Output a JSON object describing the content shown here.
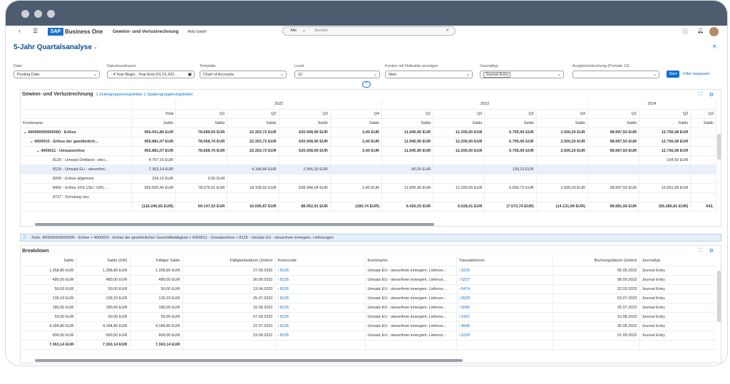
{
  "shell": {
    "app_name": "Business One",
    "sap": "SAP",
    "page": "Gewinn- und Verlustrechnung",
    "company": "ANG GmbH",
    "scope": "Alle",
    "search_placeholder": "Suchen"
  },
  "page_title": "5-Jahr Quartalsanalyse",
  "filters": [
    {
      "label": "Date:",
      "value": "Posting Date"
    },
    {
      "label": "Datumszeitraum:",
      "value": "- 4 Year:Begin...Year:End (01.01.202..."
    },
    {
      "label": "Template:",
      "value": "Chart of Accounts"
    },
    {
      "label": "Level:",
      "value": "10"
    },
    {
      "label": "Konten mit Nullsaldo anzeigen:",
      "value": "Nein"
    },
    {
      "label": "Journaltyp:",
      "value": "Journal Entry"
    },
    {
      "label": "Ausgleichsbuchung (Periode 13):",
      "value": ""
    }
  ],
  "start_label": "Start",
  "filter_label": "Filter anpassen",
  "pl": {
    "title": "Gewinn- und Verlustrechnung",
    "sub": "1 Zeilengruppierungsfelder 1 Spaltengruppierungsfelder",
    "years": [
      "2022",
      "2023",
      "2024"
    ],
    "quarters": [
      "Total",
      "Q1",
      "Q2",
      "Q3",
      "Q4",
      "Q1",
      "Q2",
      "Q3",
      "Q4",
      "Q1",
      "Q2",
      "Q3"
    ],
    "saldo": "Saldo",
    "kontoname": "Kontoname",
    "rows": [
      {
        "name": "400000000000000 - Erlöse",
        "lvl": 1,
        "bold": true,
        "v": [
          "956.001,86 EUR",
          "78.689,55 EUR",
          "22.353,72 EUR",
          "620.008,90 EUR",
          "2,40 EUR",
          "11.945,90 EUR",
          "12.200,00 EUR",
          "6.795,95 EUR",
          "2.500,20 EUR",
          "98.997,50 EUR",
          "12.756,08 EUR",
          ""
        ]
      },
      {
        "name": "4000010 - Erlöse der gewöhnlich...",
        "lvl": 2,
        "bold": true,
        "v": [
          "955.881,07 EUR",
          "78.568,76 EUR",
          "22.353,72 EUR",
          "620.008,90 EUR",
          "2,40 EUR",
          "11.945,90 EUR",
          "12.200,00 EUR",
          "6.795,95 EUR",
          "2.500,20 EUR",
          "98.997,50 EUR",
          "12.756,08 EUR",
          ""
        ]
      },
      {
        "name": "4000011 - Umsatzerlöse",
        "lvl": 3,
        "bold": true,
        "v": [
          "955.881,07 EUR",
          "78.568,76 EUR",
          "22.353,72 EUR",
          "620.008,90 EUR",
          "2,40 EUR",
          "11.945,90 EUR",
          "12.200,00 EUR",
          "6.795,95 EUR",
          "2.500,20 EUR",
          "98.997,50 EUR",
          "12.756,08 EUR",
          ""
        ]
      },
      {
        "name": "8120 - Umsatz Drittland - steu...",
        "lvl": 4,
        "bold": false,
        "v": [
          "4.767,16 EUR",
          "",
          "",
          "",
          "",
          "",
          "",
          "",
          "",
          "",
          "104,50 EUR",
          ""
        ]
      },
      {
        "name": "8125 - Umsatz EU - steuerfrei...",
        "lvl": 4,
        "bold": false,
        "sel": true,
        "v": [
          "7.363,14 EUR",
          "",
          "4.184,80 EUR",
          "2.956,30 EUR",
          "",
          "50,00 EUR",
          "",
          "139,23 EUR",
          "",
          "",
          "",
          ""
        ]
      },
      {
        "name": "8200 - Erlöse allgemein",
        "lvl": 4,
        "bold": false,
        "v": [
          "154,15 EUR",
          "6,55 EUR",
          "",
          "",
          "",
          "",
          "",
          "",
          "",
          "",
          "",
          ""
        ]
      },
      {
        "name": "8400 - Erlöse 16% USt / 19% ...",
        "lvl": 4,
        "bold": false,
        "v": [
          "955.506,46 EUR",
          "78.576,61 EUR",
          "18.168,92 EUR",
          "628.948,04 EUR",
          "2,40 EUR",
          "11.895,90 EUR",
          "12.200,00 EUR",
          "6.656,72 EUR",
          "2.500,20 EUR",
          "98.997,50 EUR",
          "12.651,58 EUR",
          ""
        ]
      },
      {
        "name": "8727 - Schulung neu",
        "lvl": 4,
        "bold": false,
        "v": [
          "",
          "",
          "",
          "",
          "",
          "",
          "",
          "",
          "",
          "",
          "",
          ""
        ]
      }
    ],
    "total": [
      "(116.246,65 EUR)",
      "69.147,92 EUR",
      "16.695,87 EUR",
      "88.052,91 EUR",
      "(180,74 EUR)",
      "6.426,03 EUR",
      "9.028,01 EUR",
      "(7.573,74 EUR)",
      "(14.131,99 EUR)",
      "98.981,06 EUR",
      "(56.286,81 EUR)",
      "642,"
    ]
  },
  "info": "Zeile: 400000000000000 - Erlöse > 4000010 - Erlöse der gewöhnlichen Geschäftstätigkeit > 4000011 - Umsatzerlöse > 8125 - Umsatz EU - steuerfreie innergem. Lieferungen",
  "bd": {
    "title": "Breakdown",
    "headers": [
      "Saldo",
      "Saldo (SW)",
      "Fälliger Saldo",
      "Fälligkeitsdatum (Zeilen)",
      "Kontocode",
      "Kontoname",
      "Transaktionsnr.",
      "Buchungsdatum (Zeilen)",
      "Journaltyp"
    ],
    "rows": [
      [
        "1.358,80 EUR",
        "1.358,80 EUR",
        "1.358,80 EUR",
        "27.09.2022",
        "8125",
        "Umsatz EU - steuerfreie innergem. Lieferun...",
        "5226",
        "05.09.2022",
        "Journal Entry"
      ],
      [
        "480,00 EUR",
        "480,00 EUR",
        "480,00 EUR",
        "30.09.2022",
        "8125",
        "Umsatz EU - steuerfreie innergem. Lieferun...",
        "5227",
        "08.09.2022",
        "Journal Entry"
      ],
      [
        "50,00 EUR",
        "50,00 EUR",
        "50,00 EUR",
        "13.04.2023",
        "8125",
        "Umsatz EU - steuerfreie innergem. Lieferun...",
        "5474",
        "22.03.2023",
        "Journal Entry"
      ],
      [
        "139,23 EUR",
        "139,23 EUR",
        "139,23 EUR",
        "25.07.2023",
        "8125",
        "Umsatz EU - steuerfreie innergem. Lieferun...",
        "5529",
        "03.07.2023",
        "Journal Entry"
      ],
      [
        "180,00 EUR",
        "180,00 EUR",
        "180,00 EUR",
        "16.08.2022",
        "8125",
        "Umsatz EU - steuerfreie innergem. Lieferun...",
        "5095",
        "25.07.2022",
        "Journal Entry"
      ],
      [
        "50,00 EUR",
        "50,00 EUR",
        "50,00 EUR",
        "07.09.2022",
        "8125",
        "Umsatz EU - steuerfreie innergem. Lieferun...",
        "5167",
        "16.08.2022",
        "Journal Entry"
      ],
      [
        "4.184,80 EUR",
        "4.184,80 EUR",
        "4.184,80 EUR",
        "22.07.2022",
        "8125",
        "Umsatz EU - steuerfreie innergem. Lieferun...",
        "4946",
        "30.06.2022",
        "Journal Entry"
      ],
      [
        "900,00 EUR",
        "900,00 EUR",
        "900,00 EUR",
        "23.09.2022",
        "8125",
        "Umsatz EU - steuerfreie innergem. Lieferun...",
        "5225",
        "01.09.2022",
        "Journal Entry"
      ]
    ],
    "total": [
      "7.363,14 EUR",
      "7.363,14 EUR",
      "7.363,14 EUR"
    ]
  }
}
